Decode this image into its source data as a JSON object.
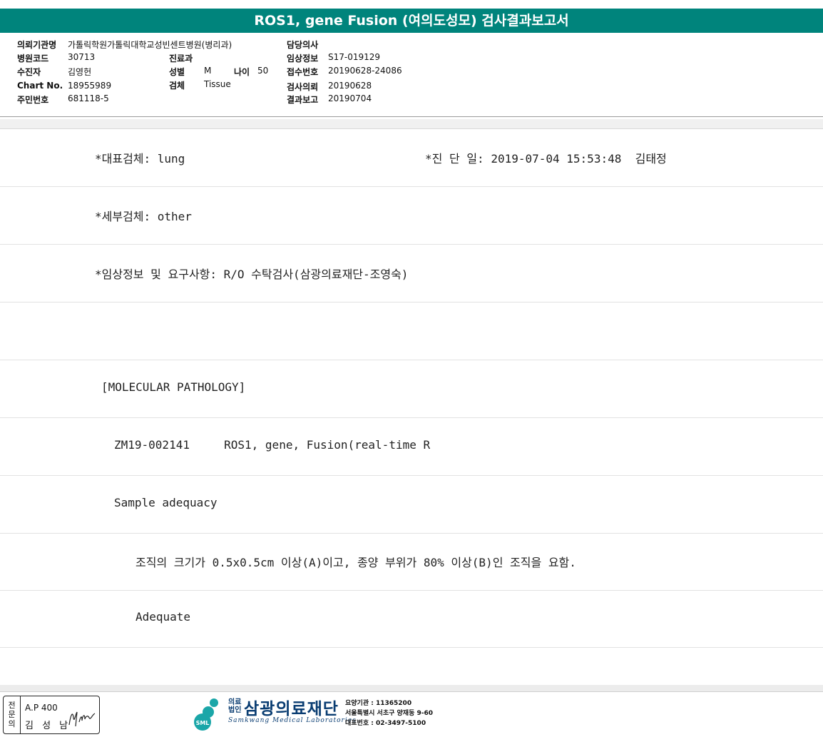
{
  "title": "ROS1, gene Fusion (여의도성모) 검사결과보고서",
  "info": {
    "institution_label": "의뢰기관명",
    "institution_value": "가톨릭학원가톨릭대학교성빈센트병원(병리과)",
    "hospital_code_label": "병원코드",
    "hospital_code_value": "30713",
    "department_label": "진료과",
    "department_value": "",
    "patient_label": "수진자",
    "patient_value": "김영헌",
    "sex_label": "성별",
    "sex_value": "M",
    "age_label": "나이",
    "age_value": "50",
    "chart_label": "Chart No.",
    "chart_value": "18955989",
    "specimen_label": "검체",
    "specimen_value": "Tissue",
    "resident_label": "주민번호",
    "resident_value": "681118-5",
    "doctor_label": "담당의사",
    "doctor_value": "",
    "clinical_label": "임상정보",
    "clinical_value": "S17-019129",
    "receipt_label": "접수번호",
    "receipt_value": "20190628-24086",
    "request_label": "검사의뢰",
    "request_value": "20190628",
    "report_label": "결과보고",
    "report_value": "20190704"
  },
  "report_lines": {
    "line1_left": "*대표검체: lung",
    "line1_right": "*진 단 일: 2019-07-04 15:53:48  김태정",
    "line2": "*세부검체: other",
    "line3": "*임상정보 및 요구사항: R/O 수탁검사(삼광의료재단-조영숙)",
    "line4": "",
    "line5": "[MOLECULAR PATHOLOGY]",
    "line6": "ZM19-002141     ROS1, gene, Fusion(real-time R",
    "line7": "Sample adequacy",
    "line8": "조직의 크기가 0.5x0.5cm 이상(A)이고, 종양 부위가 80% 이상(B)인 조직을 요함.",
    "line9": "Adequate"
  },
  "footer": {
    "stamp_vertical": "전문의",
    "stamp_ap": "A.P 400",
    "stamp_doctor": "김 성 남",
    "org_type": "의료\n법인",
    "org_name": "삼광의료재단",
    "org_english": "Samkwang Medical Laboratories",
    "org_code": "요양기관 : 11365200",
    "org_address": "서울특별시 서초구 양재동 9-60",
    "org_phone": "대표번호 : 02-3497-5100",
    "logo_text": "SML"
  },
  "colors": {
    "title_bar": "#00847c",
    "org_blue": "#0a3d72",
    "logo_teal": "#1aa6a8"
  }
}
